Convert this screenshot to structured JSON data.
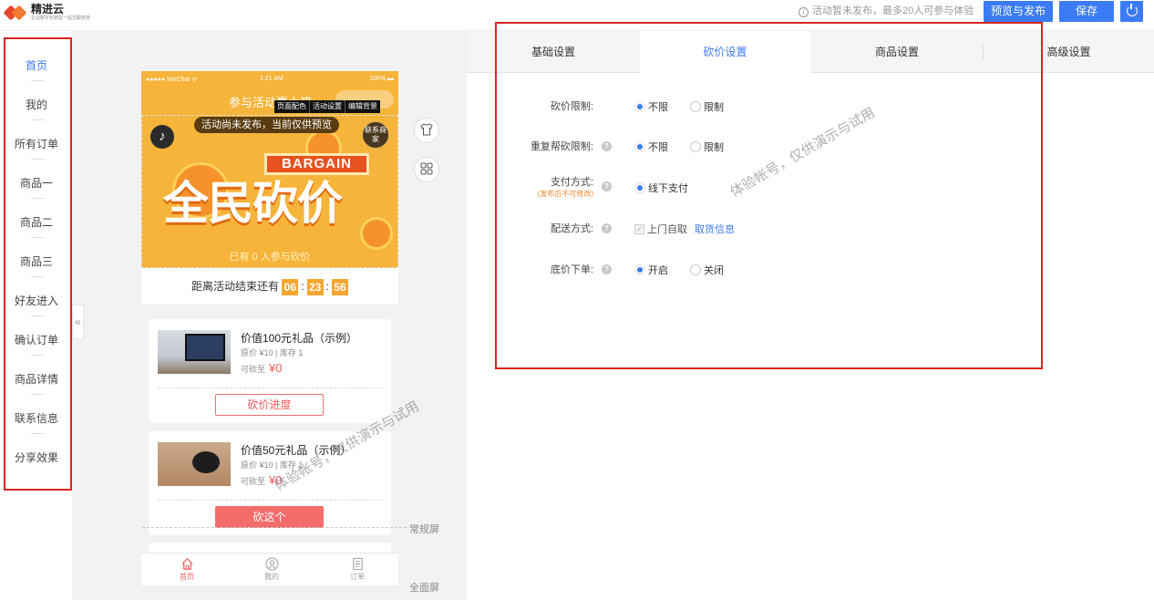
{
  "brand": {
    "name": "精进云",
    "subtitle": "企业数字化转型一站式服务商"
  },
  "header": {
    "notice": "活动暂未发布，最多20人可参与体验",
    "preview_publish": "预览与发布",
    "save": "保存"
  },
  "sidebar": {
    "items": [
      {
        "label": "首页"
      },
      {
        "label": "我的"
      },
      {
        "label": "所有订单"
      },
      {
        "label": "商品一"
      },
      {
        "label": "商品二"
      },
      {
        "label": "商品三"
      },
      {
        "label": "好友进入"
      },
      {
        "label": "确认订单"
      },
      {
        "label": "商品详情"
      },
      {
        "label": "联系信息"
      },
      {
        "label": "分享效果"
      }
    ],
    "collapse": "«"
  },
  "phone": {
    "carrier": "●●●●● WeChat ᯤ",
    "time": "1:21 AM",
    "battery": "100% ▬",
    "title": "参与活动赢大奖",
    "edit_options": [
      "页面配色",
      "活动设置",
      "编辑背景"
    ],
    "preview_notice": "活动尚未发布，当前仅供预览",
    "contact_badge": "联系商家",
    "banner": "BARGAIN",
    "big_title": "全民砍价",
    "joined_text": "已有 0 人参与砍价",
    "countdown": {
      "label": "距离活动结束还有",
      "hours": "06",
      "minutes": "23",
      "seconds": "56"
    },
    "products": [
      {
        "name": "价值100元礼品（示例）",
        "meta": "原价 ¥10 | 库存 1",
        "price_label": "可砍至",
        "price": "¥0",
        "button": "砍价进度"
      },
      {
        "name": "价值50元礼品（示例）",
        "meta": "原价 ¥10 | 库存 1",
        "price_label": "可砍至",
        "price": "¥0",
        "button": "砍这个"
      }
    ],
    "tabbar": [
      {
        "label": "首页",
        "icon": "home-icon"
      },
      {
        "label": "我的",
        "icon": "user-icon"
      },
      {
        "label": "订单",
        "icon": "order-icon"
      }
    ]
  },
  "preview_tools": {
    "theme_icon": "shirt-icon",
    "layout_icon": "grid-icon",
    "normal_screen": "常规屏",
    "full_screen": "全面屏"
  },
  "watermark": "体验帐号，仅供演示与试用",
  "settings": {
    "tabs": [
      {
        "label": "基础设置"
      },
      {
        "label": "砍价设置"
      },
      {
        "label": "商品设置"
      },
      {
        "label": "高级设置"
      }
    ],
    "active_tab": "砍价设置",
    "fields": {
      "bargain_limit": {
        "label": "砍价限制:",
        "options": [
          "不限",
          "限制"
        ],
        "selected": "不限"
      },
      "repeat_help": {
        "label": "重复帮砍限制:",
        "options": [
          "不限",
          "限制"
        ],
        "selected": "不限"
      },
      "payment": {
        "label": "支付方式:",
        "note": "(发布后不可修改)",
        "option": "线下支付",
        "selected": "线下支付"
      },
      "delivery": {
        "label": "配送方式:",
        "option": "上门自取",
        "checked": true,
        "link": "取货信息"
      },
      "floor_order": {
        "label": "底价下单:",
        "options": [
          "开启",
          "关闭"
        ],
        "selected": "开启"
      }
    }
  },
  "colors": {
    "accent": "#3b7bf5",
    "highlight_border": "#d9251c",
    "price": "#f05b5b",
    "banner_bg": "#f6b43a"
  }
}
